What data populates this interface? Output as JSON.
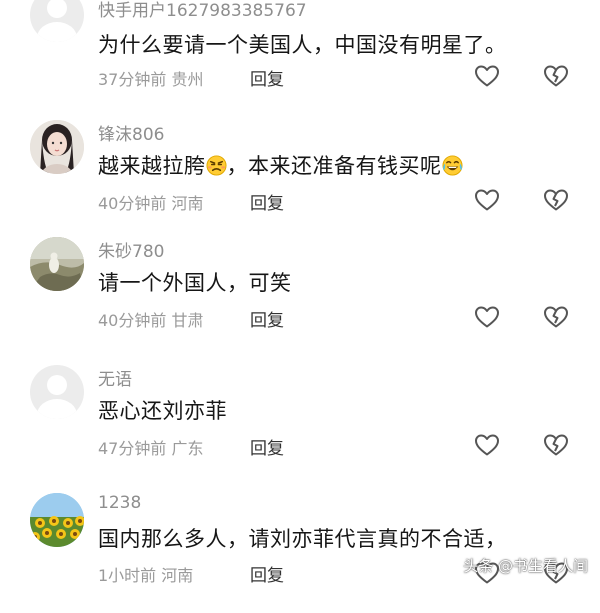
{
  "comments": [
    {
      "username": "快手用户1627983385767",
      "text": "为什么要请一个美国人，中国没有明星了。",
      "time": "37分钟前",
      "location": "贵州",
      "reply_label": "回复",
      "avatar": "default-avatar"
    },
    {
      "username": "锋沫806",
      "text_before": "越来越拉胯",
      "emoji1": "angry-face",
      "text_middle": "，本来还准备有钱买呢",
      "emoji2": "tears-of-joy-face",
      "time": "40分钟前",
      "location": "河南",
      "reply_label": "回复",
      "avatar": "girl-photo-avatar"
    },
    {
      "username": "朱砂780",
      "text": "请一个外国人，可笑",
      "time": "40分钟前",
      "location": "甘肃",
      "reply_label": "回复",
      "avatar": "landscape-avatar"
    },
    {
      "username": "无语",
      "text": "恶心还刘亦菲",
      "time": "47分钟前",
      "location": "广东",
      "reply_label": "回复",
      "avatar": "default-avatar"
    },
    {
      "username": "1238",
      "text": "国内那么多人，请刘亦菲代言真的不合适，",
      "time": "1小时前",
      "location": "河南",
      "reply_label": "回复",
      "avatar": "sunflower-avatar"
    }
  ],
  "watermark": "头条 @书生看人间",
  "icons": {
    "like": "heart-outline-icon",
    "dislike": "broken-heart-outline-icon"
  }
}
